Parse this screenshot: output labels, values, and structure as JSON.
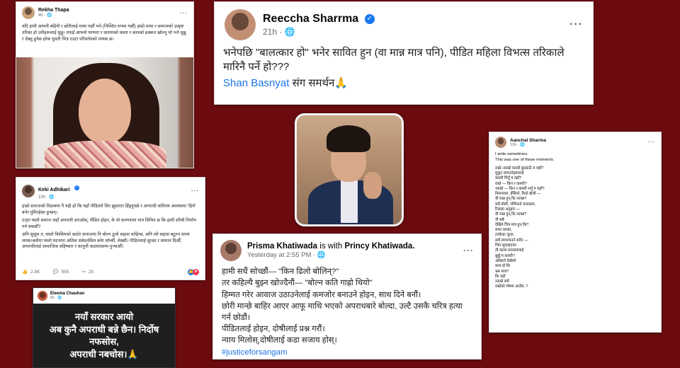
{
  "rekha": {
    "name": "Rekha Thapa",
    "time": "4h · 🌐",
    "text": "यदि हामी आफ्नी बहिनी र छोरीलाई माया गर्छौं भने (निश्चित रुपमा गर्छौं) हाम्रो माया र सम्मानको उत्कृष्ट तरिका हो उनीहरूलाई सुन्नु। तपाईं आफ्नो परम्परा र धारणाको चश्मा र कानको ढक्कन खोल्नु भो भने सुन्नु र देख्नु हुनेछ हरेक युवती भित्र एउटा परिवर्तनको नायक छ।"
  },
  "reeccha": {
    "name": "Reeccha Sharrma",
    "time": "21h · 🌐",
    "text": "भनेपछि \"बालत्कार हो\" भनेर सावित हुन (वा मान्न मात्र पनि), पीडित महिला विभत्स तरिकाले मारिनै पर्ने हो???",
    "mention": "Shan Basnyat",
    "support": "संग समर्थन🙏"
  },
  "aanchal": {
    "name": "Aanchal Sharma",
    "time": "22h · 🌐",
    "intro": [
      "I write sometimes.",
      "This was one of those moments."
    ],
    "poem": [
      "राम्रो–नराम्रो कसरी छुट्याऊँ म यहाँ?",
      "मुकुट लगाउनेहरूलाई",
      "कसरी चिनूँ म यहाँ?",
      "राम्रो — किन र कसरी?",
      "नराम्रो — किन र कसरी भनूँ म यहाँ?",
      "मिलनसार, हँसिलो, मिठो बोली —",
      "यी राम्रा हुन् कि नराम्रा?",
      "सधैं बोली, गम्भिरतो चालढाल,",
      "रिसाहा अनुहार —",
      "यी राम्रा हुन् कि नराम्रा?",
      "यी सबै",
      "देखिने चित्र मात्र हुन् कि?",
      "सफा कपडा,",
      "टल्केका जुत्ता,",
      "सधैं मगमगाउने शरीर —",
      "भित्र लुकाइएका",
      "ती काला मनसायलाई",
      "बुझूँ म कसरी?",
      "आँखाले देखेको",
      "सत्य हो कि",
      "भ्रम मात्र?",
      "कि यहाँ",
      "नराम्रो सधैं",
      "राम्रोको भेषमा आउँछ..?"
    ]
  },
  "keki": {
    "name": "Keki Adhikari",
    "time": "10h · 🌐",
    "paragraphs": [
      "हाम्रो समाजको विडम्बना नै यही हो कि यहाँ पीडितले शिर झुकाएर हिँड्नुपर्छ र अपराधी कतिपय अवस्थामा 'हिरो' बनेर घुमिरहेका हुन्छन्।",
      "एउटा यस्तो समाज जहाँ अपराधी डराओस्, पीडित होइन, के यो कल्पनामा मात्र सिमित छ कि हामी साँच्चै निर्माण गर्न सक्छौं?",
      "अनि सुसुस त, यस्तो किसिमको कठोर समाजमा नि बोल्न ठूलो सहास चाहिन्छ, अनि त्यो सहास बटुल्न समय लाग्छ।कसैमा यस्तो घटनामा अतिक संवेदनसिल बनेर सोच्यौं, लेख्यौं। पीडितलाई सुरक्षा र सम्मान दिऔँ, अपराधीलाई सामाजिक बहिष्कार र कानुनी कठघरासम्म पुर्‍याऔँ।"
    ],
    "likes": "2.8K",
    "comments": "555",
    "shares": "25"
  },
  "eleema": {
    "name": "Eleema Chauhan",
    "time": "6h · 🌐",
    "lines": [
      "नयाँ सरकार आयो",
      "अब कुनै अपराधी बन्ने छैन। निर्दोष",
      "नफसोस,",
      "अपराधी नबचोस।🙏"
    ]
  },
  "prisma": {
    "name": "Prisma Khatiwada",
    "with_text": "is with",
    "tagged": "Princy Khatiwada.",
    "time": "Yesterday at 2:55 PM · 🌐",
    "lines": [
      "हामी सधैं सोच्छौं— \"किन ढिलो बोलिन्?\"",
      "तर कहिल्यै बुझ्न खोज्दैनौं— \"बोल्न कति गाह्रो थियो\"",
      "हिम्मत गरेर आवाज उठाउनेलाई कमजोर बनाउने होइन, साथ दिने बनौं।",
      "छोरी मान्छे बाहिर आएर आफू माथि भएको अपराधबारे बोल्दा, उल्टै उसकै चरित्र हत्या गर्न छोडौं।",
      "पीडितलाई होइन, दोषीलाई प्रश्न गरौं।",
      "न्याय मिलोस्,दोषीलाई कडा सजाय होस्।"
    ],
    "hashtag": "#justiceforsangam"
  },
  "colors": {
    "background": "#6b0b0f",
    "link": "#1b74e4",
    "verified": "#1877f2"
  }
}
